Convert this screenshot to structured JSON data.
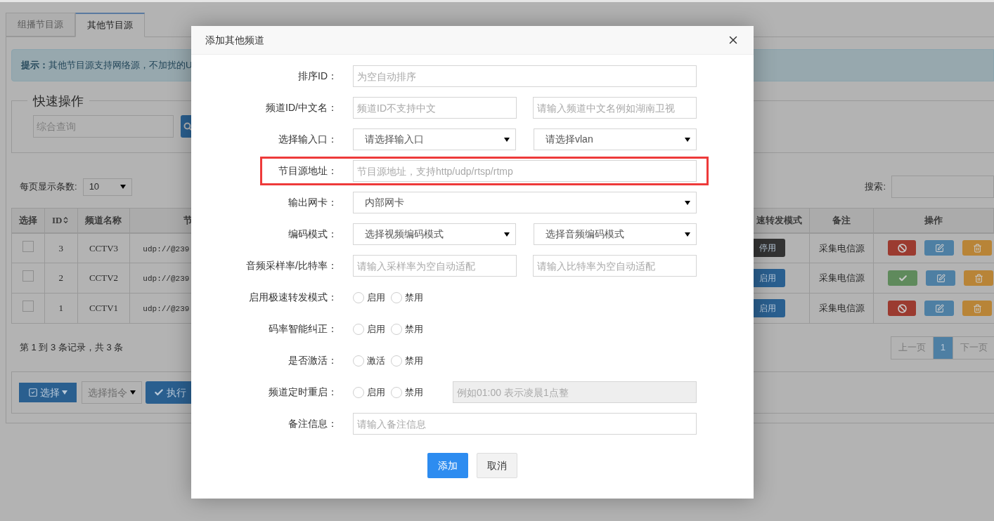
{
  "tabs": [
    {
      "label": "组播节目源",
      "selected": false
    },
    {
      "label": "其他节目源",
      "selected": true
    }
  ],
  "alert": {
    "label": "提示：",
    "text": "其他节目源支持网络源，不加扰的U"
  },
  "quick_ops": {
    "legend": "快速操作",
    "search_placeholder": "综合查询"
  },
  "page_size": {
    "label": "每页显示条数:",
    "value": "10"
  },
  "search": {
    "label": "搜索:"
  },
  "table": {
    "columns": [
      "选择",
      "ID",
      "频道名称",
      "节",
      "速转发模式",
      "备注",
      "操作"
    ],
    "rows": [
      {
        "checked": false,
        "id": "3",
        "name": "CCTV3",
        "address": "udp://@239",
        "mode": {
          "label": "停用",
          "kind": "stop"
        },
        "note": "采集电信源",
        "active": true
      },
      {
        "checked": false,
        "id": "2",
        "name": "CCTV2",
        "address": "udp://@239",
        "mode": {
          "label": "启用",
          "kind": "start"
        },
        "note": "采集电信源",
        "active": false
      },
      {
        "checked": false,
        "id": "1",
        "name": "CCTV1",
        "address": "udp://@239",
        "mode": {
          "label": "启用",
          "kind": "start"
        },
        "note": "采集电信源",
        "active": true
      }
    ]
  },
  "summary": "第 1 到 3 条记录，共 3 条",
  "pagination": [
    {
      "label": "上一页",
      "selected": false
    },
    {
      "label": "1",
      "selected": true
    },
    {
      "label": "下一页",
      "selected": false
    }
  ],
  "batch": {
    "select_button": "选择",
    "command_select": "选择指令",
    "execute_button": "执行"
  },
  "dialog": {
    "title": "添加其他频道",
    "rows": [
      {
        "label": "排序ID：",
        "highlighted": false,
        "controls": [
          {
            "kind": "input",
            "placeholder": "为空自动排序"
          }
        ]
      },
      {
        "label": "频道ID/中文名：",
        "highlighted": false,
        "controls": [
          {
            "kind": "input",
            "placeholder": "频道ID不支持中文"
          },
          {
            "kind": "input",
            "placeholder": "请输入频道中文名例如湖南卫视"
          }
        ]
      },
      {
        "label": "选择输入口：",
        "highlighted": false,
        "controls": [
          {
            "kind": "select",
            "value": "请选择输入口"
          },
          {
            "kind": "select",
            "value": "请选择vlan"
          }
        ]
      },
      {
        "label": "节目源地址：",
        "highlighted": true,
        "controls": [
          {
            "kind": "input",
            "placeholder": "节目源地址，支持http/udp/rtsp/rtmp"
          }
        ]
      },
      {
        "label": "输出网卡：",
        "highlighted": false,
        "controls": [
          {
            "kind": "select",
            "value": "内部网卡"
          }
        ]
      },
      {
        "label": "编码模式：",
        "highlighted": false,
        "controls": [
          {
            "kind": "select",
            "value": "选择视频编码模式"
          },
          {
            "kind": "select",
            "value": "选择音频编码模式"
          }
        ]
      },
      {
        "label": "音频采样率/比特率：",
        "highlighted": false,
        "controls": [
          {
            "kind": "input",
            "placeholder": "请输入采样率为空自动适配"
          },
          {
            "kind": "input",
            "placeholder": "请输入比特率为空自动适配"
          }
        ]
      },
      {
        "label": "启用极速转发模式：",
        "highlighted": false,
        "controls": [
          {
            "kind": "radio",
            "label": "启用",
            "selected": false
          },
          {
            "kind": "radio",
            "label": "禁用",
            "selected": false
          }
        ]
      },
      {
        "label": "码率智能纠正：",
        "highlighted": false,
        "controls": [
          {
            "kind": "radio",
            "label": "启用",
            "selected": false
          },
          {
            "kind": "radio",
            "label": "禁用",
            "selected": false
          }
        ]
      },
      {
        "label": "是否激活：",
        "highlighted": false,
        "controls": [
          {
            "kind": "radio",
            "label": "激活",
            "selected": false
          },
          {
            "kind": "radio",
            "label": "禁用",
            "selected": false
          }
        ]
      },
      {
        "label": "频道定时重启：",
        "highlighted": false,
        "controls": [
          {
            "kind": "radio",
            "label": "启用",
            "selected": false
          },
          {
            "kind": "radio",
            "label": "禁用",
            "selected": false
          },
          {
            "kind": "input",
            "placeholder": "例如01:00 表示凌晨1点整",
            "disabled": true
          }
        ]
      },
      {
        "label": "备注信息：",
        "highlighted": false,
        "controls": [
          {
            "kind": "input",
            "placeholder": "请输入备注信息"
          }
        ]
      }
    ],
    "buttons": [
      {
        "label": "添加",
        "kind": "primary"
      },
      {
        "label": "取消",
        "kind": "default"
      }
    ]
  }
}
